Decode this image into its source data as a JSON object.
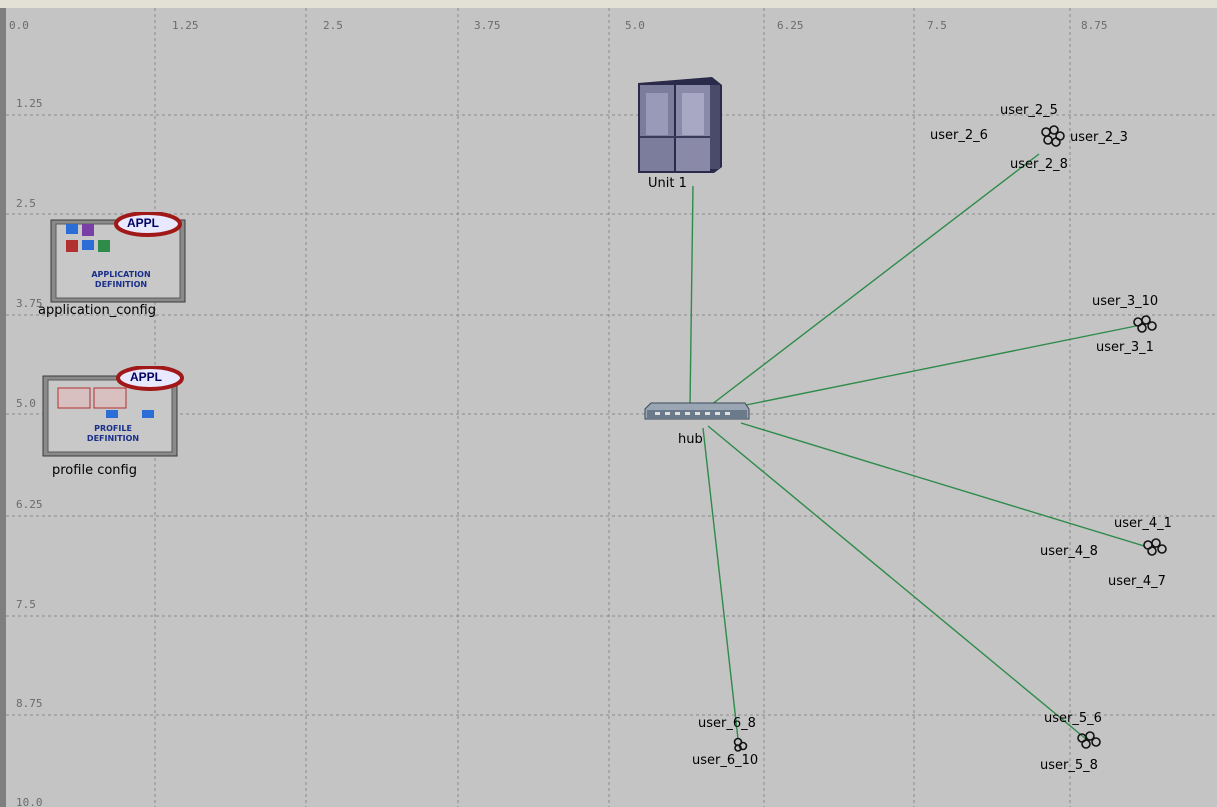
{
  "grid": {
    "x_ticks": [
      "0.0",
      "1.25",
      "2.5",
      "3.75",
      "5.0",
      "6.25",
      "7.5",
      "8.75"
    ],
    "y_ticks": [
      "1.25",
      "2.5",
      "3.75",
      "5.0",
      "6.25",
      "7.5",
      "8.75",
      "10.0"
    ]
  },
  "nodes": {
    "application_config": {
      "label": "application_config",
      "badge": "APPL",
      "caption1": "APPLICATION",
      "caption2": "DEFINITION"
    },
    "profile_config": {
      "label": "profile config",
      "badge": "APPL",
      "caption1": "PROFILE",
      "caption2": "DEFINITION"
    },
    "server": {
      "label": "Unit 1"
    },
    "hub": {
      "label": "hub"
    },
    "user_2": {
      "top": "user_2_5",
      "left": "user_2_6",
      "right": "user_2_3",
      "bottom": "user_2_8"
    },
    "user_3": {
      "top": "user_3_10",
      "bottom": "user_3_1"
    },
    "user_4": {
      "top": "user_4_1",
      "left": "user_4_8",
      "bottom": "user_4_7"
    },
    "user_5": {
      "top": "user_5_6",
      "bottom": "user_5_8"
    },
    "user_6": {
      "top": "user_6_8",
      "bottom": "user_6_10"
    }
  },
  "colors": {
    "workspace": "#c4c4c4",
    "grid": "#8a8a8a",
    "link": "#2e8b4a",
    "badge_ring": "#a01818"
  }
}
